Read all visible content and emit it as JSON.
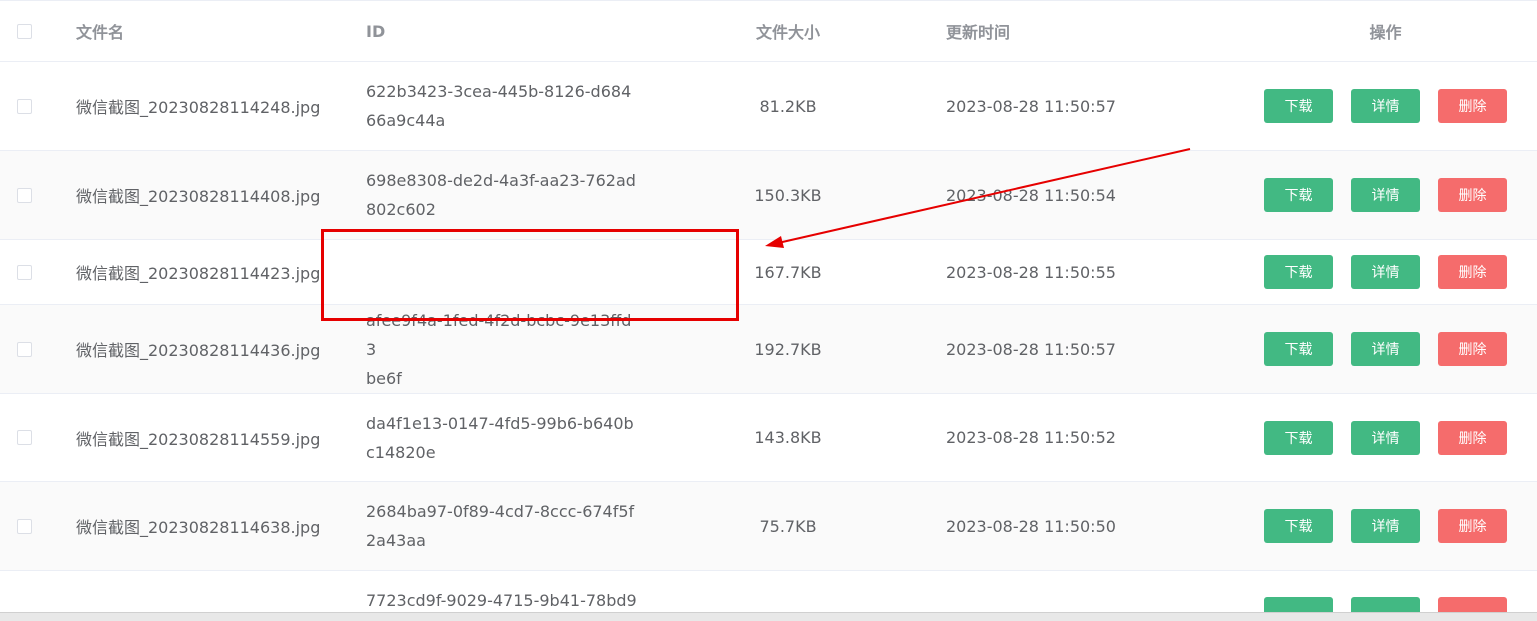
{
  "header": {
    "name": "文件名",
    "id": "ID",
    "size": "文件大小",
    "time": "更新时间",
    "ops": "操作"
  },
  "buttons": {
    "download": "下载",
    "detail": "详情",
    "delete": "删除"
  },
  "rows": [
    {
      "name": "微信截图_20230828114248.jpg",
      "id1": "622b3423-3cea-445b-8126-d684",
      "id2": "66a9c44a",
      "size": "81.2KB",
      "time": "2023-08-28 11:50:57"
    },
    {
      "name": "微信截图_20230828114408.jpg",
      "id1": "698e8308-de2d-4a3f-aa23-762ad",
      "id2": "802c602",
      "size": "150.3KB",
      "time": "2023-08-28 11:50:54"
    },
    {
      "name": "微信截图_20230828114423.jpg",
      "id1": "",
      "id2": "",
      "size": "167.7KB",
      "time": "2023-08-28 11:50:55"
    },
    {
      "name": "微信截图_20230828114436.jpg",
      "id1": "afee9f4a-1fed-4f2d-bcbc-9e13ffd3",
      "id2": "be6f",
      "size": "192.7KB",
      "time": "2023-08-28 11:50:57"
    },
    {
      "name": "微信截图_20230828114559.jpg",
      "id1": "da4f1e13-0147-4fd5-99b6-b640b",
      "id2": "c14820e",
      "size": "143.8KB",
      "time": "2023-08-28 11:50:52"
    },
    {
      "name": "微信截图_20230828114638.jpg",
      "id1": "2684ba97-0f89-4cd7-8ccc-674f5f",
      "id2": "2a43aa",
      "size": "75.7KB",
      "time": "2023-08-28 11:50:50"
    },
    {
      "name": "",
      "id1": "7723cd9f-9029-4715-9b41-78bd9",
      "id2": "",
      "size": "",
      "time": ""
    }
  ],
  "colors": {
    "primary_button": "#42b983",
    "danger_button": "#f56c6c",
    "annotation": "#e60000"
  }
}
